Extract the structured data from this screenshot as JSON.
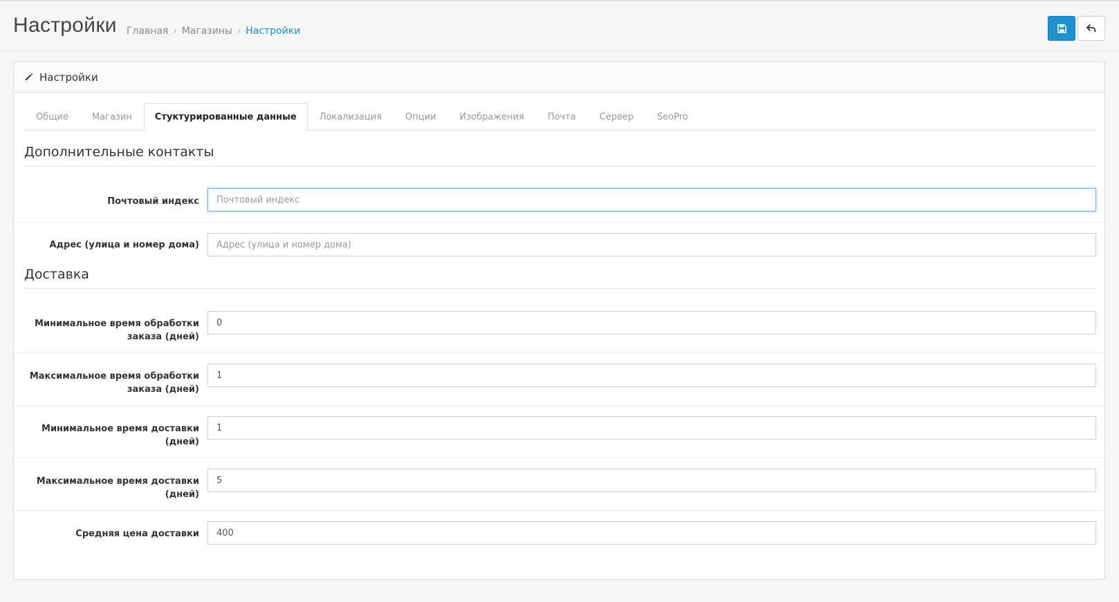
{
  "header": {
    "title": "Настройки",
    "breadcrumbs": [
      "Главная",
      "Магазины",
      "Настройки"
    ],
    "save_icon": "floppy-disk-icon",
    "back_icon": "reply-arrow-icon"
  },
  "panel": {
    "title": "Настройки",
    "icon": "pencil-icon"
  },
  "tabs": [
    {
      "label": "Общие"
    },
    {
      "label": "Магазин"
    },
    {
      "label": "Стуктурированные данные",
      "active": true
    },
    {
      "label": "Локализация"
    },
    {
      "label": "Опции"
    },
    {
      "label": "Изображения"
    },
    {
      "label": "Почта"
    },
    {
      "label": "Сервер"
    },
    {
      "label": "SeoPro"
    }
  ],
  "contacts": {
    "title": "Дополнительные контакты",
    "postal_label": "Почтовый индекс",
    "postal_placeholder": "Почтовый индекс",
    "postal_value": "",
    "address_label": "Адрес (улица и номер дома)",
    "address_placeholder": "Адрес (улица и номер дома)",
    "address_value": ""
  },
  "delivery": {
    "title": "Доставка",
    "min_processing_label": "Минимальное время обработки заказа (дней)",
    "min_processing_value": "0",
    "max_processing_label": "Максимальное время обработки заказа (дней)",
    "max_processing_value": "1",
    "min_delivery_label": "Минимальное время доставки (дней)",
    "min_delivery_value": "1",
    "max_delivery_label": "Максимальное время доставки (дней)",
    "max_delivery_value": "5",
    "avg_price_label": "Средняя цена доставки",
    "avg_price_value": "400"
  },
  "colors": {
    "primary": "#1e91cf",
    "link": "#1e91cf",
    "focus_border": "#66afe9"
  }
}
